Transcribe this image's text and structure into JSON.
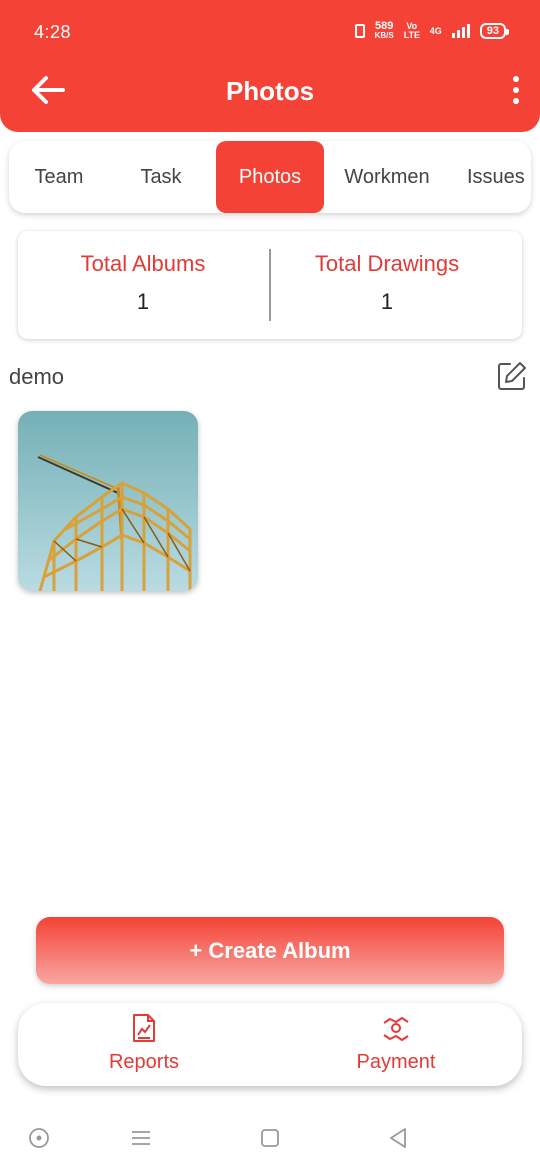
{
  "status_bar": {
    "time": "4:28",
    "net_speed": "589",
    "net_unit": "KB/S",
    "network_label": "Vo LTE",
    "network_type": "4G",
    "battery": "93"
  },
  "header": {
    "title": "Photos",
    "back_icon": "arrow-left-icon",
    "menu_icon": "more-vertical-icon"
  },
  "tabs": [
    {
      "label": "Team",
      "active": false
    },
    {
      "label": "Task",
      "active": false
    },
    {
      "label": "Photos",
      "active": true
    },
    {
      "label": "Workmen",
      "active": false
    },
    {
      "label": "Issues",
      "active": false
    }
  ],
  "stats": {
    "albums_label": "Total Albums",
    "albums_value": "1",
    "drawings_label": "Total Drawings",
    "drawings_value": "1"
  },
  "album": {
    "name": "demo",
    "edit_icon": "edit-icon"
  },
  "create_button": "+ Create Album",
  "bottom_nav": [
    {
      "label": "Reports",
      "icon": "report-icon"
    },
    {
      "label": "Payment",
      "icon": "payment-icon"
    }
  ],
  "colors": {
    "primary": "#f44336",
    "accent_text": "#e53935"
  }
}
